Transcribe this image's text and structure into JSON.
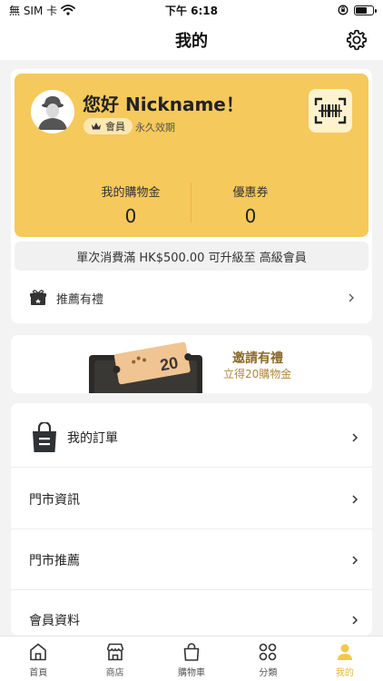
{
  "status_bar": {
    "carrier": "無 SIM 卡",
    "time": "下午 6:18"
  },
  "header": {
    "title": "我的"
  },
  "profile": {
    "greeting": "您好 Nickname！",
    "member_label": "會員",
    "validity": "永久效期"
  },
  "stats": [
    {
      "label": "我的購物金",
      "value": "0"
    },
    {
      "label": "優惠券",
      "value": "0"
    }
  ],
  "upgrade_notice": "單次消費滿 HK$500.00 可升級至 高級會員",
  "referral": {
    "label": "推薦有禮"
  },
  "invite": {
    "title": "邀請有禮",
    "subtitle": "立得20購物金",
    "coupon_value": "20"
  },
  "menu": [
    {
      "label": "我的訂單"
    },
    {
      "label": "門市資訊"
    },
    {
      "label": "門市推薦"
    },
    {
      "label": "會員資料"
    }
  ],
  "tabs": [
    {
      "label": "首頁",
      "icon": "home-icon"
    },
    {
      "label": "商店",
      "icon": "store-icon"
    },
    {
      "label": "購物車",
      "icon": "cart-icon"
    },
    {
      "label": "分類",
      "icon": "category-icon"
    },
    {
      "label": "我的",
      "icon": "profile-icon"
    }
  ],
  "colors": {
    "accent": "#f5c95b",
    "active_tab": "#e8b738",
    "background": "#f3f3f3"
  }
}
